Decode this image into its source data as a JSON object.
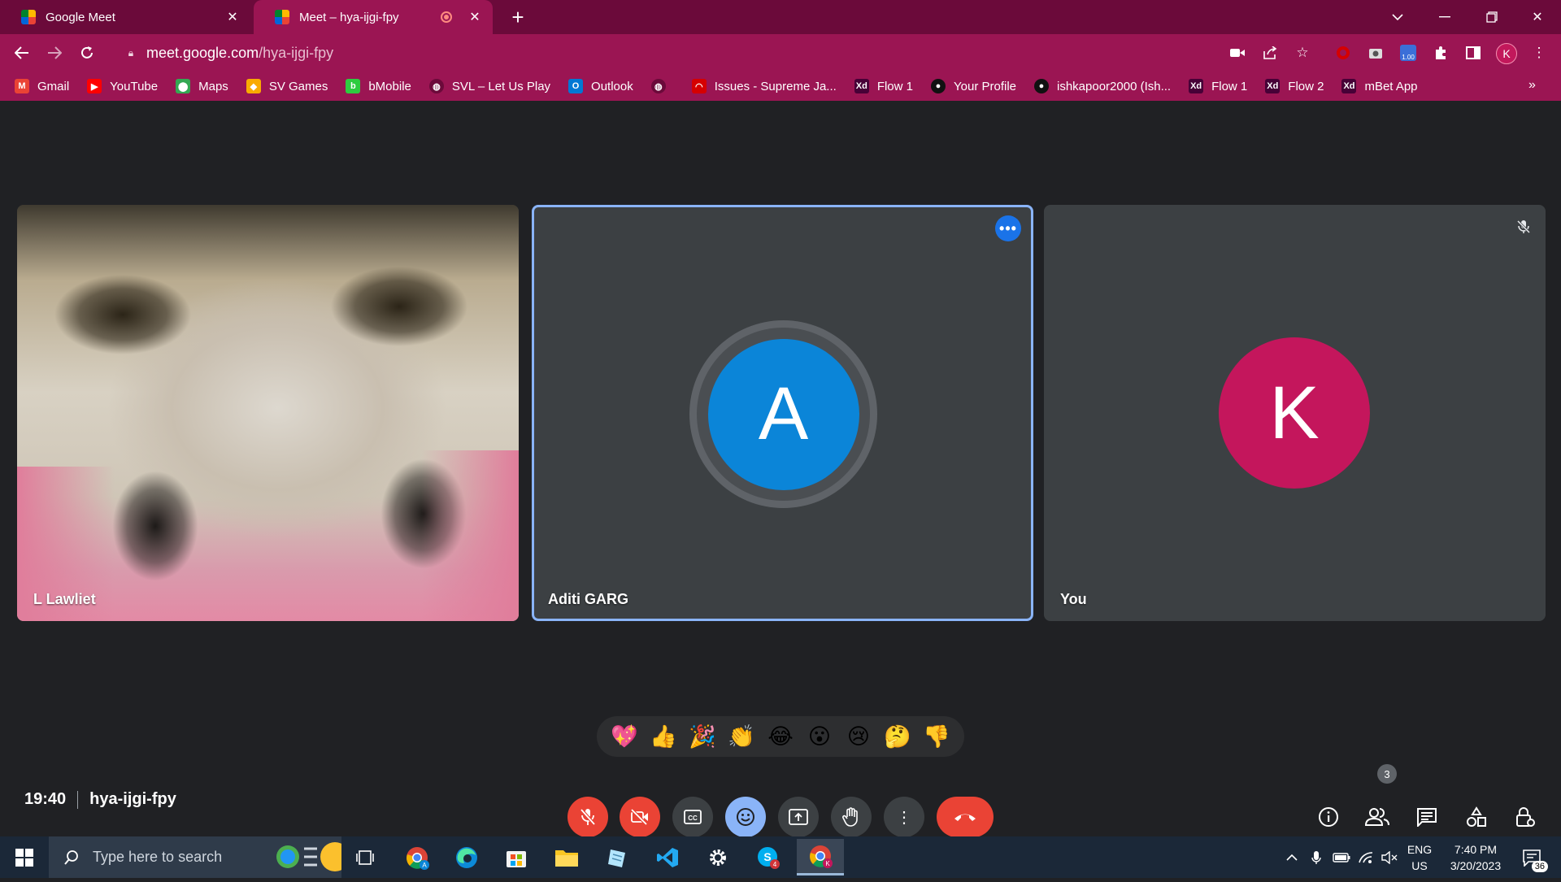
{
  "browser": {
    "tabs": [
      {
        "title": "Google Meet",
        "active": false
      },
      {
        "title": "Meet – hya-ijgi-fpy",
        "active": true
      }
    ],
    "url_host": "meet.google.com",
    "url_path": "/hya-ijgi-fpy",
    "profile_initial": "K",
    "extension_badge": "1.00",
    "bookmarks": [
      {
        "label": "Gmail",
        "icon": "gmail-icon",
        "color": "#ea4335",
        "glyph": "M"
      },
      {
        "label": "YouTube",
        "icon": "youtube-icon",
        "color": "#ff0000",
        "glyph": "▶"
      },
      {
        "label": "Maps",
        "icon": "maps-icon",
        "color": "#34a853",
        "glyph": "⬤"
      },
      {
        "label": "SV Games",
        "icon": "sv-games-icon",
        "color": "#f9ab00",
        "glyph": "◆"
      },
      {
        "label": "bMobile",
        "icon": "bmobile-icon",
        "color": "#2ecc40",
        "glyph": "b"
      },
      {
        "label": "SVL – Let Us Play",
        "icon": "globe-icon",
        "color": "#6b0a3a",
        "glyph": "◍"
      },
      {
        "label": "Outlook",
        "icon": "outlook-icon",
        "color": "#0078d4",
        "glyph": "O"
      },
      {
        "label": "",
        "icon": "globe-icon",
        "color": "#6b0a3a",
        "glyph": "◍"
      },
      {
        "label": "Issues - Supreme Ja...",
        "icon": "issues-icon",
        "color": "#d50000",
        "glyph": "◠"
      },
      {
        "label": "Flow 1",
        "icon": "xd-icon",
        "color": "#470137",
        "glyph": "Xd"
      },
      {
        "label": "Your Profile",
        "icon": "github-icon",
        "color": "#111111",
        "glyph": "●"
      },
      {
        "label": "ishkapoor2000 (Ish...",
        "icon": "github-icon",
        "color": "#111111",
        "glyph": "●"
      },
      {
        "label": "Flow 1",
        "icon": "xd-icon",
        "color": "#470137",
        "glyph": "Xd"
      },
      {
        "label": "Flow 2",
        "icon": "xd-icon",
        "color": "#470137",
        "glyph": "Xd"
      },
      {
        "label": "mBet App",
        "icon": "xd-icon",
        "color": "#470137",
        "glyph": "Xd"
      }
    ],
    "more_bookmarks": "»"
  },
  "meet": {
    "participants": [
      {
        "name": "L Lawliet",
        "type": "video"
      },
      {
        "name": "Aditi GARG",
        "type": "avatar",
        "initial": "A",
        "color": "#0b85d8",
        "speaking": true
      },
      {
        "name": "You",
        "type": "avatar",
        "initial": "K",
        "color": "#c4165c",
        "muted": true
      }
    ],
    "reactions": [
      "💖",
      "👍",
      "🎉",
      "👏",
      "😂",
      "😮",
      "😢",
      "🤔",
      "👎"
    ],
    "time": "19:40",
    "meeting_code": "hya-ijgi-fpy",
    "people_count": "3"
  },
  "taskbar": {
    "search_placeholder": "Type here to search",
    "lang_top": "ENG",
    "lang_bottom": "US",
    "clock_time": "7:40 PM",
    "clock_date": "3/20/2023",
    "notification_count": "36",
    "chat_badge": "4"
  }
}
